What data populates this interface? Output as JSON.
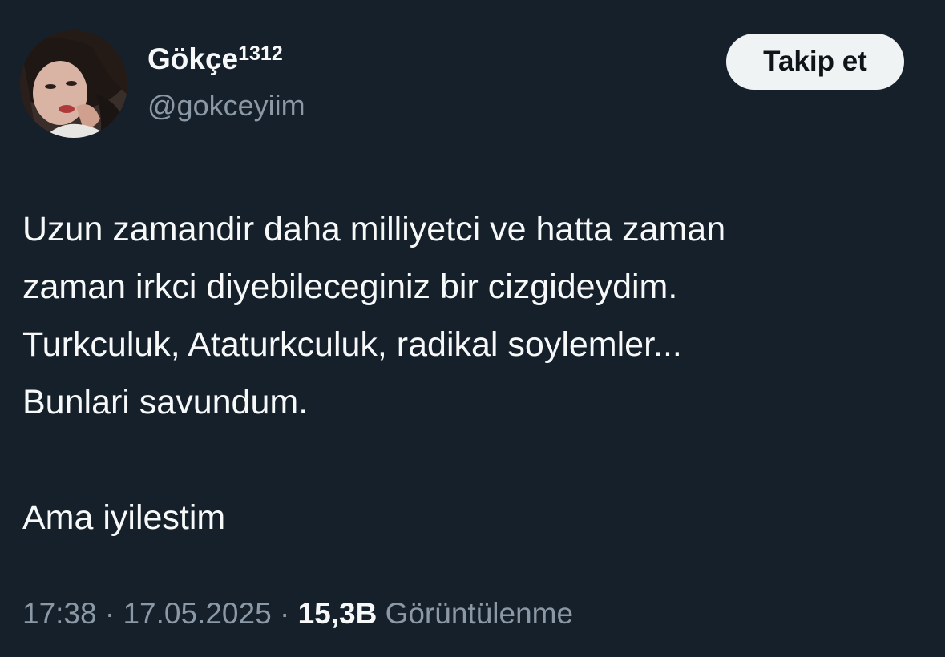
{
  "user": {
    "display_name": "Gökçe",
    "display_name_suffix": "1312",
    "handle": "@gokceyiim",
    "avatar_icon": "profile-photo"
  },
  "follow_button": {
    "label": "Takip et"
  },
  "tweet": {
    "text": "Uzun zamandir daha milliyetci ve hatta zaman\nzaman irkci diyebileceginiz bir cizgideydim.\nTurkculuk, Ataturkculuk, radikal soylemler...\nBunlari savundum.\n\nAma iyilestim",
    "time": "17:38",
    "separator": "·",
    "date": "17.05.2025",
    "views_count": "15,3B",
    "views_label": "Görüntülenme"
  },
  "colors": {
    "background": "#15202b",
    "primary_text": "#f7f9f9",
    "secondary_text": "#8b98a5",
    "button_bg": "#eff3f4",
    "button_text": "#0f1419"
  }
}
